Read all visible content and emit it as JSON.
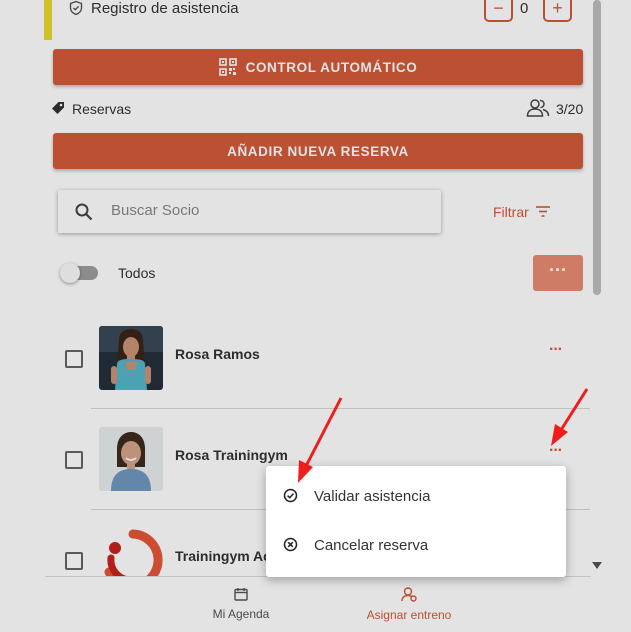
{
  "attendance": {
    "label": "Registro de asistencia",
    "count": "0",
    "minus": "−",
    "plus": "+"
  },
  "auto_button": {
    "label": "CONTROL AUTOMÁTICO"
  },
  "reservations": {
    "label": "Reservas",
    "capacity": "3/20"
  },
  "new_reservation_button": {
    "label": "AÑADIR NUEVA RESERVA"
  },
  "search": {
    "placeholder": "Buscar Socio"
  },
  "filter": {
    "label": "Filtrar"
  },
  "toggle_all": {
    "label": "Todos",
    "on": false
  },
  "bulk_more": {
    "label": "···"
  },
  "members": [
    {
      "name": "Rosa Ramos",
      "more": "···"
    },
    {
      "name": "Rosa Trainingym",
      "more": "···"
    },
    {
      "name": "Trainingym Ac",
      "more": "···"
    }
  ],
  "context_menu": {
    "items": [
      {
        "label": "Validar asistencia",
        "icon": "check-circle-icon"
      },
      {
        "label": "Cancelar reserva",
        "icon": "x-circle-icon"
      }
    ]
  },
  "bottom_nav": {
    "items": [
      {
        "label": "Mi Agenda",
        "icon": "calendar-icon",
        "active": false
      },
      {
        "label": "Asignar entreno",
        "icon": "user-assign-icon",
        "active": true
      }
    ]
  },
  "colors": {
    "accent": "#d35a3a",
    "accent_light": "#e98c73",
    "highlight_bar": "#e8d930",
    "annotation_arrow": "#f01d1d"
  }
}
